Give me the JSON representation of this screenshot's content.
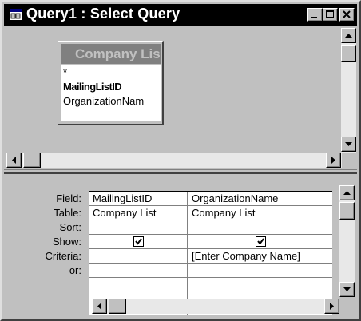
{
  "window": {
    "title": "Query1 : Select Query",
    "controls": [
      "minimize-icon",
      "maximize-icon",
      "close-icon"
    ]
  },
  "field_list": {
    "title": "Company List",
    "items": [
      "*",
      "MailingListID",
      "OrganizationNam"
    ]
  },
  "design_grid": {
    "row_labels": [
      "Field:",
      "Table:",
      "Sort:",
      "Show:",
      "Criteria:",
      "or:"
    ],
    "columns": [
      {
        "field": "MailingListID",
        "table": "Company List",
        "sort": "",
        "show": true,
        "criteria": "",
        "or": ""
      },
      {
        "field": "OrganizationName",
        "table": "Company List",
        "sort": "",
        "show": true,
        "criteria": "[Enter Company Name]",
        "or": ""
      }
    ]
  },
  "colors": {
    "face": "#c0c0c0",
    "titlebar": "#000000",
    "shadow": "#808080"
  }
}
